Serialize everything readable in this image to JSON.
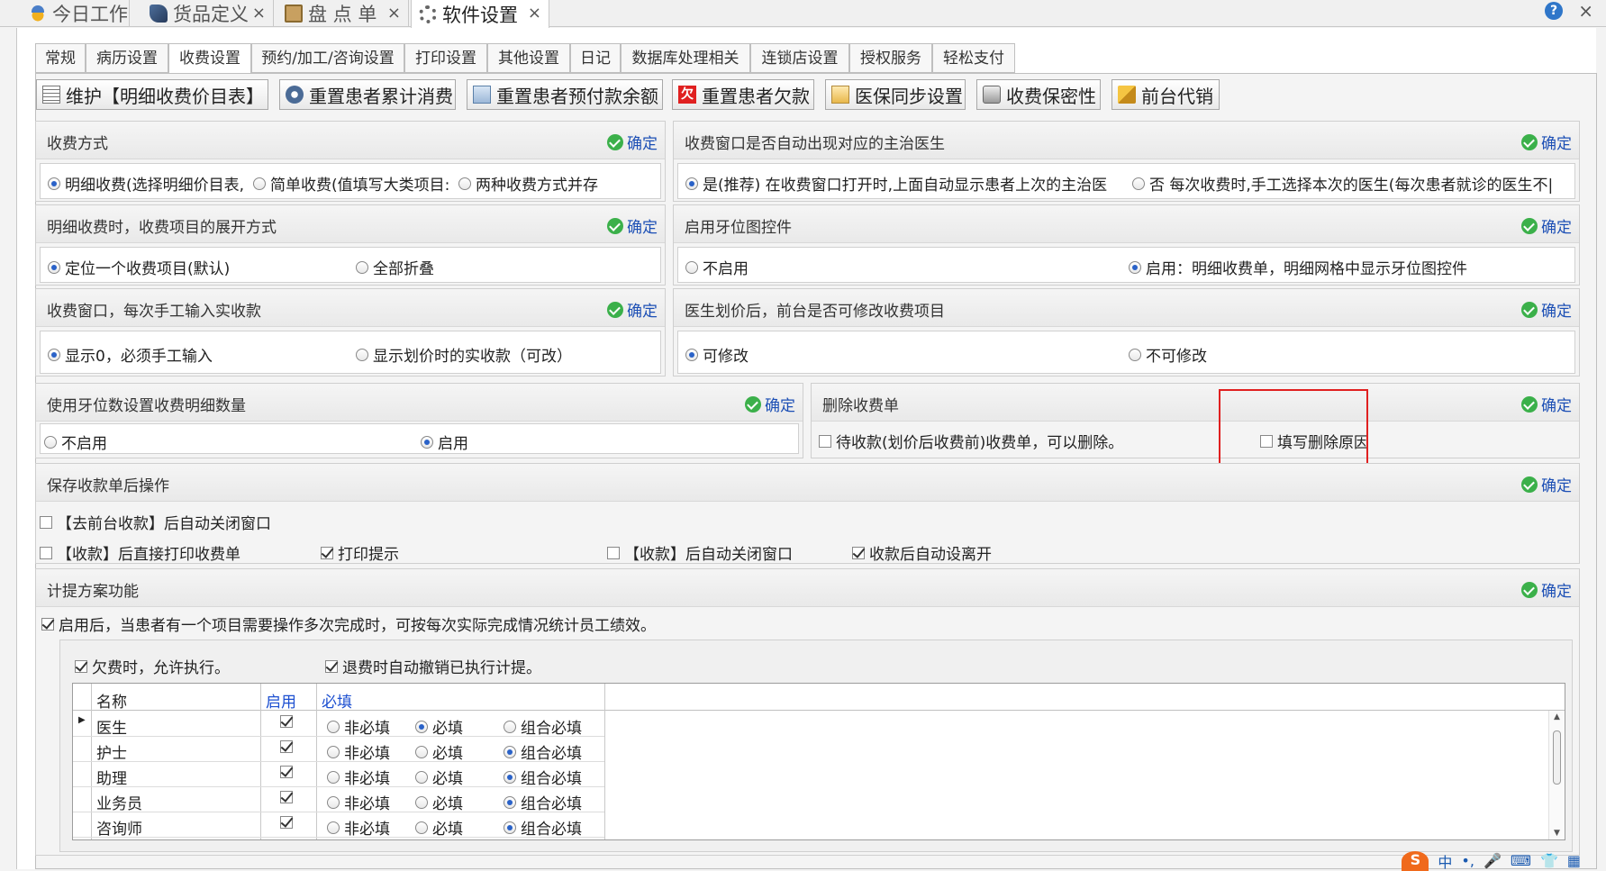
{
  "doc_tabs": [
    {
      "label": "今日工作",
      "icon": "sun-icon"
    },
    {
      "label": "货品定义",
      "icon": "tag-icon"
    },
    {
      "label": "盘 点 单",
      "icon": "box-icon"
    },
    {
      "label": "软件设置",
      "icon": "gear-icon"
    }
  ],
  "window": {
    "help": "?",
    "close": "×"
  },
  "settings_tabs": [
    "常规",
    "病历设置",
    "收费设置",
    "预约/加工/咨询设置",
    "打印设置",
    "其他设置",
    "日记",
    "数据库处理相关",
    "连锁店设置",
    "授权服务",
    "轻松支付"
  ],
  "active_settings_tab": "收费设置",
  "toolbar": {
    "maintain": "维护【明细收费价目表】",
    "reset_total": "重置患者累计消费",
    "reset_prepay": "重置患者预付款余额",
    "owe_icon_text": "欠",
    "reset_owe": "重置患者欠款",
    "insurance_sync": "医保同步设置",
    "secrecy": "收费保密性",
    "front_agent": "前台代销"
  },
  "confirm_label": "确定",
  "groups": {
    "charge_mode": {
      "title": "收费方式",
      "options": [
        "明细收费(选择明细价目表,",
        "简单收费(值填写大类项目:",
        "两种收费方式并存"
      ],
      "selected": 0
    },
    "auto_doctor": {
      "title": "收费窗口是否自动出现对应的主治医生",
      "options": [
        "是(推荐)  在收费窗口打开时,上面自动显示患者上次的主治医",
        "否  每次收费时,手工选择本次的医生(每次患者就诊的医生不|"
      ],
      "selected": 0
    },
    "expand_mode": {
      "title": "明细收费时，收费项目的展开方式",
      "options": [
        "定位一个收费项目(默认)",
        "全部折叠"
      ],
      "selected": 0
    },
    "tooth_chart": {
      "title": "启用牙位图控件",
      "options": [
        "不启用",
        "启用：明细收费单，明细网格中显示牙位图控件"
      ],
      "selected": 1
    },
    "manual_input": {
      "title": "收费窗口，每次手工输入实收款",
      "options": [
        "显示0，必须手工输入",
        "显示划价时的实收款（可改）"
      ],
      "selected": 0
    },
    "modify_items": {
      "title": "医生划价后，前台是否可修改收费项目",
      "options": [
        "可修改",
        "不可修改"
      ],
      "selected": 0
    },
    "tooth_count": {
      "title": "使用牙位数设置收费明细数量",
      "options": [
        "不启用",
        "启用"
      ],
      "selected": 1
    },
    "delete_bill": {
      "title": "删除收费单",
      "checks": [
        {
          "label": "待收款(划价后收费前)收费单，可以删除。",
          "checked": false
        },
        {
          "label": "填写删除原因",
          "checked": false
        }
      ]
    },
    "after_save": {
      "title": "保存收款单后操作",
      "checks": [
        {
          "label": "【去前台收款】后自动关闭窗口",
          "checked": false
        },
        {
          "label": "【收款】后直接打印收费单",
          "checked": false
        },
        {
          "label": "打印提示",
          "checked": true
        },
        {
          "label": "【收款】后自动关闭窗口",
          "checked": false
        },
        {
          "label": "收款后自动设离开",
          "checked": true
        }
      ]
    },
    "commission": {
      "title": "计提方案功能",
      "enable_label": "启用后，当患者有一个项目需要操作多次完成时，可按每次实际完成情况统计员工绩效。",
      "enable_checked": true,
      "allow_owe": {
        "label": "欠费时，允许执行。",
        "checked": true
      },
      "refund_cancel": {
        "label": "退费时自动撤销已执行计提。",
        "checked": true
      }
    }
  },
  "grid": {
    "headers": {
      "name": "名称",
      "enabled": "启用",
      "required": "必填"
    },
    "required_options": [
      "非必填",
      "必填",
      "组合必填"
    ],
    "rows": [
      {
        "name": "医生",
        "enabled": true,
        "required": 1
      },
      {
        "name": "护士",
        "enabled": true,
        "required": 2
      },
      {
        "name": "助理",
        "enabled": true,
        "required": 2
      },
      {
        "name": "业务员",
        "enabled": true,
        "required": 2
      },
      {
        "name": "咨询师",
        "enabled": true,
        "required": 2
      }
    ]
  },
  "ime": {
    "logo": "S",
    "lang": "中"
  },
  "colors": {
    "accent": "#2a62c8",
    "confirm_icon": "#3bb04a",
    "highlight": "#e02020",
    "link": "#1c4fb5"
  }
}
